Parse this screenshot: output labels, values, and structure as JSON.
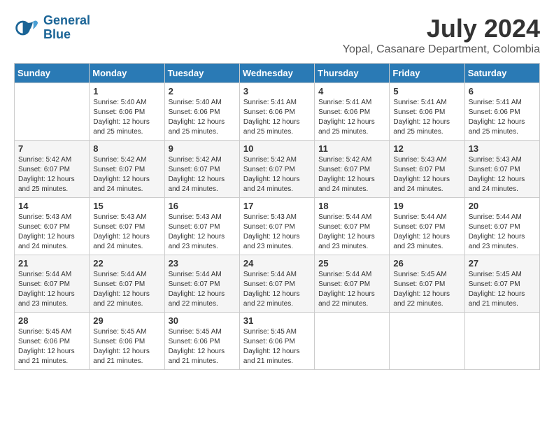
{
  "logo": {
    "line1": "General",
    "line2": "Blue"
  },
  "header": {
    "month_year": "July 2024",
    "location": "Yopal, Casanare Department, Colombia"
  },
  "days_of_week": [
    "Sunday",
    "Monday",
    "Tuesday",
    "Wednesday",
    "Thursday",
    "Friday",
    "Saturday"
  ],
  "weeks": [
    [
      {
        "date": "",
        "info": ""
      },
      {
        "date": "1",
        "info": "Sunrise: 5:40 AM\nSunset: 6:06 PM\nDaylight: 12 hours\nand 25 minutes."
      },
      {
        "date": "2",
        "info": "Sunrise: 5:40 AM\nSunset: 6:06 PM\nDaylight: 12 hours\nand 25 minutes."
      },
      {
        "date": "3",
        "info": "Sunrise: 5:41 AM\nSunset: 6:06 PM\nDaylight: 12 hours\nand 25 minutes."
      },
      {
        "date": "4",
        "info": "Sunrise: 5:41 AM\nSunset: 6:06 PM\nDaylight: 12 hours\nand 25 minutes."
      },
      {
        "date": "5",
        "info": "Sunrise: 5:41 AM\nSunset: 6:06 PM\nDaylight: 12 hours\nand 25 minutes."
      },
      {
        "date": "6",
        "info": "Sunrise: 5:41 AM\nSunset: 6:06 PM\nDaylight: 12 hours\nand 25 minutes."
      }
    ],
    [
      {
        "date": "7",
        "info": "Sunrise: 5:42 AM\nSunset: 6:07 PM\nDaylight: 12 hours\nand 25 minutes."
      },
      {
        "date": "8",
        "info": "Sunrise: 5:42 AM\nSunset: 6:07 PM\nDaylight: 12 hours\nand 24 minutes."
      },
      {
        "date": "9",
        "info": "Sunrise: 5:42 AM\nSunset: 6:07 PM\nDaylight: 12 hours\nand 24 minutes."
      },
      {
        "date": "10",
        "info": "Sunrise: 5:42 AM\nSunset: 6:07 PM\nDaylight: 12 hours\nand 24 minutes."
      },
      {
        "date": "11",
        "info": "Sunrise: 5:42 AM\nSunset: 6:07 PM\nDaylight: 12 hours\nand 24 minutes."
      },
      {
        "date": "12",
        "info": "Sunrise: 5:43 AM\nSunset: 6:07 PM\nDaylight: 12 hours\nand 24 minutes."
      },
      {
        "date": "13",
        "info": "Sunrise: 5:43 AM\nSunset: 6:07 PM\nDaylight: 12 hours\nand 24 minutes."
      }
    ],
    [
      {
        "date": "14",
        "info": "Sunrise: 5:43 AM\nSunset: 6:07 PM\nDaylight: 12 hours\nand 24 minutes."
      },
      {
        "date": "15",
        "info": "Sunrise: 5:43 AM\nSunset: 6:07 PM\nDaylight: 12 hours\nand 24 minutes."
      },
      {
        "date": "16",
        "info": "Sunrise: 5:43 AM\nSunset: 6:07 PM\nDaylight: 12 hours\nand 23 minutes."
      },
      {
        "date": "17",
        "info": "Sunrise: 5:43 AM\nSunset: 6:07 PM\nDaylight: 12 hours\nand 23 minutes."
      },
      {
        "date": "18",
        "info": "Sunrise: 5:44 AM\nSunset: 6:07 PM\nDaylight: 12 hours\nand 23 minutes."
      },
      {
        "date": "19",
        "info": "Sunrise: 5:44 AM\nSunset: 6:07 PM\nDaylight: 12 hours\nand 23 minutes."
      },
      {
        "date": "20",
        "info": "Sunrise: 5:44 AM\nSunset: 6:07 PM\nDaylight: 12 hours\nand 23 minutes."
      }
    ],
    [
      {
        "date": "21",
        "info": "Sunrise: 5:44 AM\nSunset: 6:07 PM\nDaylight: 12 hours\nand 23 minutes."
      },
      {
        "date": "22",
        "info": "Sunrise: 5:44 AM\nSunset: 6:07 PM\nDaylight: 12 hours\nand 22 minutes."
      },
      {
        "date": "23",
        "info": "Sunrise: 5:44 AM\nSunset: 6:07 PM\nDaylight: 12 hours\nand 22 minutes."
      },
      {
        "date": "24",
        "info": "Sunrise: 5:44 AM\nSunset: 6:07 PM\nDaylight: 12 hours\nand 22 minutes."
      },
      {
        "date": "25",
        "info": "Sunrise: 5:44 AM\nSunset: 6:07 PM\nDaylight: 12 hours\nand 22 minutes."
      },
      {
        "date": "26",
        "info": "Sunrise: 5:45 AM\nSunset: 6:07 PM\nDaylight: 12 hours\nand 22 minutes."
      },
      {
        "date": "27",
        "info": "Sunrise: 5:45 AM\nSunset: 6:07 PM\nDaylight: 12 hours\nand 21 minutes."
      }
    ],
    [
      {
        "date": "28",
        "info": "Sunrise: 5:45 AM\nSunset: 6:06 PM\nDaylight: 12 hours\nand 21 minutes."
      },
      {
        "date": "29",
        "info": "Sunrise: 5:45 AM\nSunset: 6:06 PM\nDaylight: 12 hours\nand 21 minutes."
      },
      {
        "date": "30",
        "info": "Sunrise: 5:45 AM\nSunset: 6:06 PM\nDaylight: 12 hours\nand 21 minutes."
      },
      {
        "date": "31",
        "info": "Sunrise: 5:45 AM\nSunset: 6:06 PM\nDaylight: 12 hours\nand 21 minutes."
      },
      {
        "date": "",
        "info": ""
      },
      {
        "date": "",
        "info": ""
      },
      {
        "date": "",
        "info": ""
      }
    ]
  ]
}
